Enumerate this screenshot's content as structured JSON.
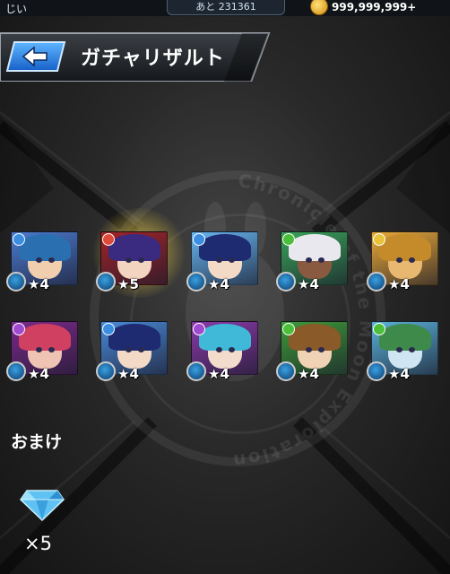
{
  "status_bar": {
    "player_name": "じい",
    "exp_remaining": "あと 231361",
    "coin_icon": "gold-coin-icon",
    "coin_count": "999,999,999+"
  },
  "header": {
    "back_icon": "back-arrow-icon",
    "title": "ガチャリザルト"
  },
  "results": [
    {
      "rarity": "★4",
      "element": "water",
      "accent": "#3a8de0",
      "hair": "#2a6fb0",
      "skin": "#f1cfae",
      "bg": "#4c7bd0"
    },
    {
      "rarity": "★5",
      "element": "fire",
      "accent": "#e04a3a",
      "hair": "#3a2a80",
      "skin": "#f2d4c0",
      "bg": "#a0242a",
      "highlighted": true
    },
    {
      "rarity": "★4",
      "element": "water",
      "accent": "#3a8de0",
      "hair": "#1e2b70",
      "skin": "#f3dac6",
      "bg": "#66b5f0"
    },
    {
      "rarity": "★4",
      "element": "wood",
      "accent": "#4bbf3a",
      "hair": "#e8e8ee",
      "skin": "#8a5a40",
      "bg": "#3aa25a"
    },
    {
      "rarity": "★4",
      "element": "light",
      "accent": "#e8c23a",
      "hair": "#c58a2a",
      "skin": "#e8b870",
      "bg": "#e7a838"
    },
    {
      "rarity": "★4",
      "element": "dark",
      "accent": "#a04ad0",
      "hair": "#d04060",
      "skin": "#f0c4b4",
      "bg": "#7a2a8a"
    },
    {
      "rarity": "★4",
      "element": "water",
      "accent": "#3a8de0",
      "hair": "#1e2b70",
      "skin": "#f3dac6",
      "bg": "#4a8ad8"
    },
    {
      "rarity": "★4",
      "element": "dark",
      "accent": "#a04ad0",
      "hair": "#40b8d8",
      "skin": "#f4dccc",
      "bg": "#8a3aa8"
    },
    {
      "rarity": "★4",
      "element": "wood",
      "accent": "#4bbf3a",
      "hair": "#8a5a28",
      "skin": "#f0d2b4",
      "bg": "#3e9a3a"
    },
    {
      "rarity": "★4",
      "element": "wood",
      "accent": "#4bbf3a",
      "hair": "#3e8a4a",
      "skin": "#cfe6f2",
      "bg": "#5ab0d8"
    }
  ],
  "bonus": {
    "label": "おまけ",
    "item_icon": "diamond-gem-icon",
    "count": "×5"
  },
  "emblem_text": "Chronicle of the Moon Exploration"
}
